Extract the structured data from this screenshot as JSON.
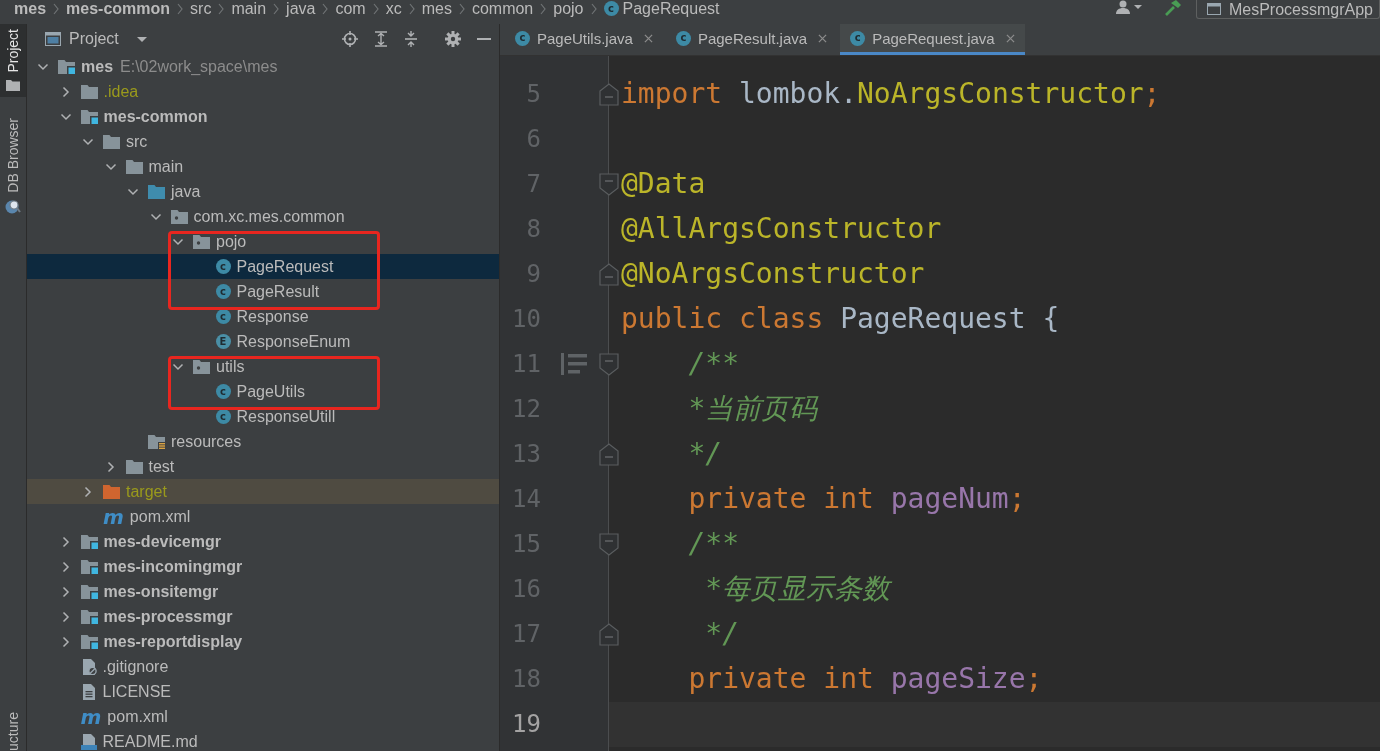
{
  "navigation_bar": {
    "breadcrumbs": [
      {
        "label": "mes",
        "kind": "module"
      },
      {
        "label": "mes-common",
        "kind": "module"
      },
      {
        "label": "src",
        "kind": "folder"
      },
      {
        "label": "main",
        "kind": "folder"
      },
      {
        "label": "java",
        "kind": "folder"
      },
      {
        "label": "com",
        "kind": "folder"
      },
      {
        "label": "xc",
        "kind": "folder"
      },
      {
        "label": "mes",
        "kind": "folder"
      },
      {
        "label": "common",
        "kind": "folder"
      },
      {
        "label": "pojo",
        "kind": "folder"
      },
      {
        "label": "PageRequest",
        "kind": "class",
        "badge": "c"
      }
    ],
    "run_config": "MesProcessmgrApp"
  },
  "tool_strip": {
    "top": [
      {
        "label": "Project",
        "kind": "project",
        "selected": true
      },
      {
        "label": "DB Browser",
        "kind": "database",
        "selected": false
      }
    ],
    "bottom": [
      {
        "label": "ucture",
        "selected": false
      }
    ]
  },
  "project_panel": {
    "title": "Project",
    "tree": [
      {
        "label": "mes",
        "kind": "module",
        "path": "E:\\02work_space\\mes",
        "expanded": true,
        "selected": false,
        "children": [
          {
            "label": ".idea",
            "kind": "folder",
            "ignored": true,
            "expanded": false,
            "selected": false
          },
          {
            "label": "mes-common",
            "kind": "module",
            "expanded": true,
            "selected": false,
            "children": [
              {
                "label": "src",
                "kind": "folder",
                "expanded": true,
                "selected": false,
                "children": [
                  {
                    "label": "main",
                    "kind": "folder",
                    "expanded": true,
                    "selected": false,
                    "children": [
                      {
                        "label": "java",
                        "kind": "source-folder",
                        "expanded": true,
                        "selected": false,
                        "children": [
                          {
                            "label": "com.xc.mes.common",
                            "kind": "package",
                            "expanded": true,
                            "selected": false,
                            "children": [
                              {
                                "label": "pojo",
                                "kind": "package",
                                "expanded": true,
                                "selected": false,
                                "framed": true,
                                "children": [
                                  {
                                    "label": "PageRequest",
                                    "kind": "class",
                                    "badge": "c",
                                    "selected": true,
                                    "framed": true
                                  },
                                  {
                                    "label": "PageResult",
                                    "kind": "class",
                                    "badge": "c",
                                    "selected": false,
                                    "framed": true
                                  },
                                  {
                                    "label": "Response",
                                    "kind": "class",
                                    "badge": "c",
                                    "selected": false
                                  },
                                  {
                                    "label": "ResponseEnum",
                                    "kind": "enum",
                                    "badge": "E",
                                    "selected": false
                                  }
                                ]
                              },
                              {
                                "label": "utils",
                                "kind": "package",
                                "expanded": true,
                                "selected": false,
                                "framed": true,
                                "children": [
                                  {
                                    "label": "PageUtils",
                                    "kind": "class",
                                    "badge": "c",
                                    "selected": false,
                                    "framed": true
                                  },
                                  {
                                    "label": "ResponseUtill",
                                    "kind": "class",
                                    "badge": "c",
                                    "selected": false
                                  }
                                ]
                              }
                            ]
                          }
                        ]
                      },
                      {
                        "label": "resources",
                        "kind": "resources-folder",
                        "selected": false
                      }
                    ]
                  },
                  {
                    "label": "test",
                    "kind": "folder",
                    "expanded": false,
                    "selected": false
                  }
                ]
              },
              {
                "label": "target",
                "kind": "excluded-folder",
                "ignored": true,
                "expanded": false,
                "selected": false
              },
              {
                "label": "pom.xml",
                "kind": "maven",
                "badge": "m",
                "selected": false
              }
            ]
          },
          {
            "label": "mes-devicemgr",
            "kind": "module",
            "expanded": false,
            "selected": false
          },
          {
            "label": "mes-incomingmgr",
            "kind": "module",
            "expanded": false,
            "selected": false
          },
          {
            "label": "mes-onsitemgr",
            "kind": "module",
            "expanded": false,
            "selected": false
          },
          {
            "label": "mes-processmgr",
            "kind": "module",
            "expanded": false,
            "selected": false
          },
          {
            "label": "mes-reportdisplay",
            "kind": "module",
            "expanded": false,
            "selected": false
          },
          {
            "label": ".gitignore",
            "kind": "ignore-file",
            "selected": false
          },
          {
            "label": "LICENSE",
            "kind": "text-file",
            "selected": false
          },
          {
            "label": "pom.xml",
            "kind": "maven",
            "badge": "m",
            "selected": false
          },
          {
            "label": "README.md",
            "kind": "markdown",
            "selected": false
          }
        ]
      }
    ]
  },
  "editor": {
    "tabs": [
      {
        "label": "PageUtils.java",
        "badge": "c",
        "selected": false
      },
      {
        "label": "PageResult.java",
        "badge": "c",
        "selected": false
      },
      {
        "label": "PageRequest.java",
        "badge": "c",
        "selected": true
      }
    ],
    "lines": [
      {
        "number": "5",
        "kind": "fold-end",
        "current": false,
        "tokens": [
          {
            "kind": "keyword",
            "text": "import"
          },
          {
            "kind": "plain",
            "text": " lombok."
          },
          {
            "kind": "annotation",
            "text": "NoArgsConstructor"
          },
          {
            "kind": "keyword",
            "text": ";"
          }
        ]
      },
      {
        "number": "6",
        "kind": "code",
        "current": false
      },
      {
        "number": "7",
        "kind": "fold-start",
        "current": false,
        "tokens": [
          {
            "kind": "annotation",
            "text": "@Data"
          }
        ]
      },
      {
        "number": "8",
        "kind": "code",
        "current": false,
        "tokens": [
          {
            "kind": "annotation",
            "text": "@AllArgsConstructor"
          }
        ]
      },
      {
        "number": "9",
        "kind": "fold-end",
        "current": false,
        "tokens": [
          {
            "kind": "annotation",
            "text": "@NoArgsConstructor"
          }
        ]
      },
      {
        "number": "10",
        "kind": "code",
        "current": false,
        "tokens": [
          {
            "kind": "keyword",
            "text": "public class "
          },
          {
            "kind": "plain",
            "text": "PageRequest {"
          }
        ]
      },
      {
        "number": "11",
        "kind": "fold-start",
        "doc_toggle": true,
        "current": false,
        "tokens": [
          {
            "kind": "comment",
            "text": "    /**"
          }
        ]
      },
      {
        "number": "12",
        "kind": "code",
        "current": false,
        "tokens": [
          {
            "kind": "comment",
            "text": "    *当前页码"
          }
        ]
      },
      {
        "number": "13",
        "kind": "fold-end",
        "current": false,
        "tokens": [
          {
            "kind": "comment",
            "text": "    */"
          }
        ]
      },
      {
        "number": "14",
        "kind": "code",
        "current": false,
        "tokens": [
          {
            "kind": "keyword",
            "text": "    private int "
          },
          {
            "kind": "field",
            "text": "pageNum"
          },
          {
            "kind": "keyword",
            "text": ";"
          }
        ]
      },
      {
        "number": "15",
        "kind": "fold-start",
        "current": false,
        "tokens": [
          {
            "kind": "comment",
            "text": "    /**"
          }
        ]
      },
      {
        "number": "16",
        "kind": "code",
        "current": false,
        "tokens": [
          {
            "kind": "comment",
            "text": "     *每页显示条数"
          }
        ]
      },
      {
        "number": "17",
        "kind": "fold-end",
        "current": false,
        "tokens": [
          {
            "kind": "comment",
            "text": "     */"
          }
        ]
      },
      {
        "number": "18",
        "kind": "code",
        "current": false,
        "tokens": [
          {
            "kind": "keyword",
            "text": "    private int "
          },
          {
            "kind": "field",
            "text": "pageSize"
          },
          {
            "kind": "keyword",
            "text": ";"
          }
        ]
      },
      {
        "number": "19",
        "kind": "code",
        "current": true
      }
    ]
  }
}
